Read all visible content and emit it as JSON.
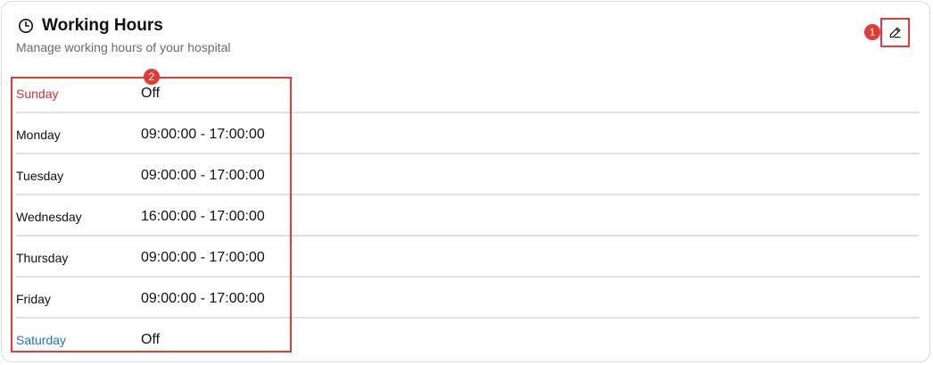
{
  "header": {
    "title": "Working Hours",
    "subtitle": "Manage working hours of your hospital",
    "icon": "clock-icon"
  },
  "actions": {
    "edit_icon": "pencil-icon"
  },
  "annotations": {
    "badge_1": "1",
    "badge_2": "2",
    "color": "#e53935"
  },
  "colors": {
    "sunday": "#d32f2f",
    "saturday": "#1e6fd9",
    "divider": "#e0e0e0"
  },
  "schedule": [
    {
      "day": "Sunday",
      "hours": "Off"
    },
    {
      "day": "Monday",
      "hours": "09:00:00 - 17:00:00"
    },
    {
      "day": "Tuesday",
      "hours": "09:00:00 - 17:00:00"
    },
    {
      "day": "Wednesday",
      "hours": "16:00:00 - 17:00:00"
    },
    {
      "day": "Thursday",
      "hours": "09:00:00 - 17:00:00"
    },
    {
      "day": "Friday",
      "hours": "09:00:00 - 17:00:00"
    },
    {
      "day": "Saturday",
      "hours": "Off"
    }
  ]
}
